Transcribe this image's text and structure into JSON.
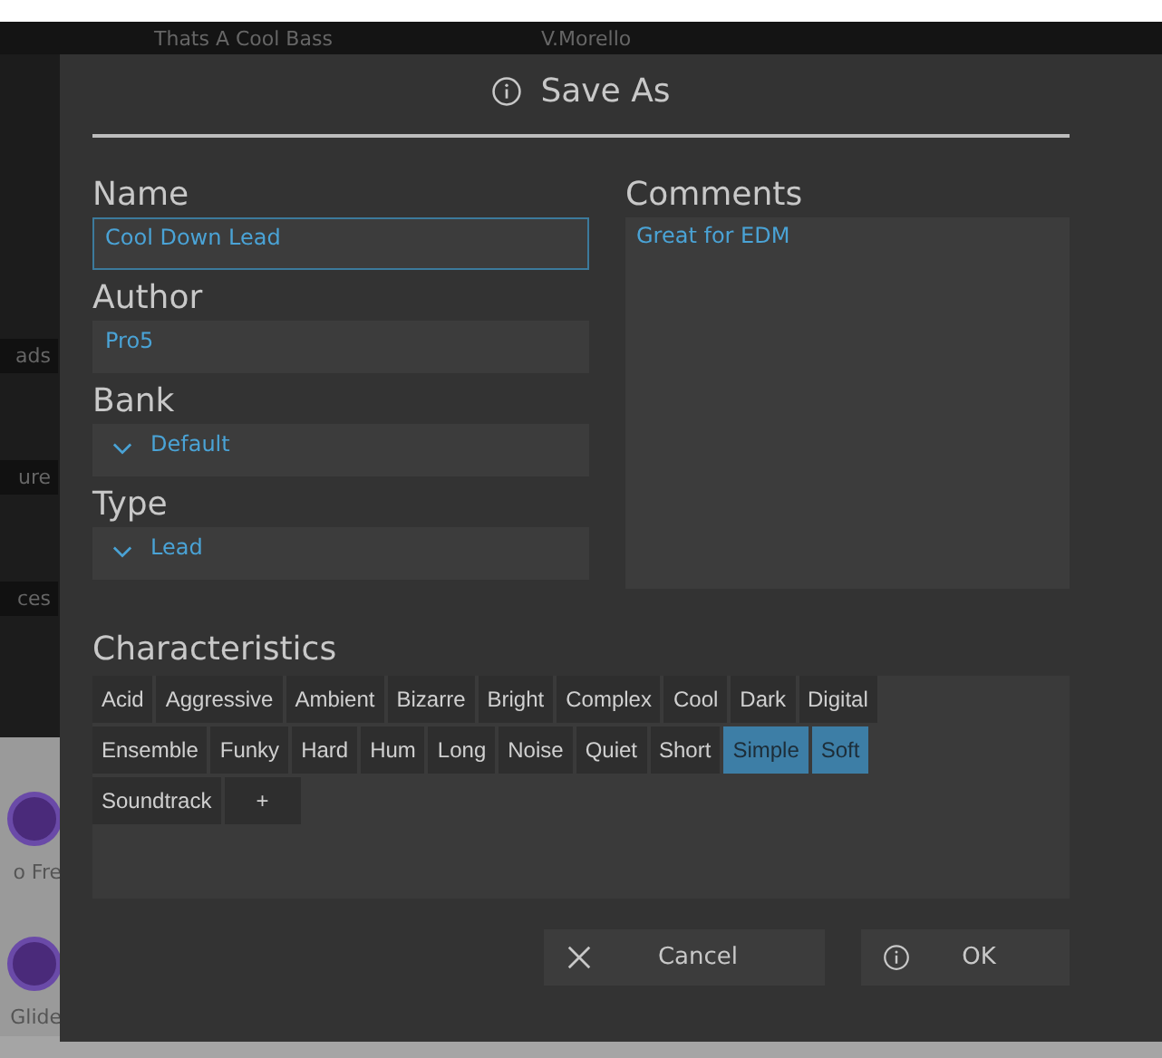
{
  "background": {
    "preset_row": {
      "name": "Thats A Cool Bass",
      "author": "V.Morello"
    },
    "side_tags": [
      "ads",
      "ure",
      "ces"
    ],
    "knob_labels": [
      "o Fre",
      "Glide"
    ]
  },
  "dialog": {
    "title": "Save As",
    "fields": [
      {
        "label": "Name",
        "kind": "text",
        "value": "Cool Down Lead",
        "focused": true
      },
      {
        "label": "Author",
        "kind": "text",
        "value": "Pro5",
        "focused": false
      },
      {
        "label": "Bank",
        "kind": "dropdown",
        "value": "Default",
        "focused": false
      },
      {
        "label": "Type",
        "kind": "dropdown",
        "value": "Lead",
        "focused": false
      }
    ],
    "comments": {
      "label": "Comments",
      "value": "Great for EDM"
    },
    "characteristics": {
      "label": "Characteristics",
      "tags": [
        {
          "label": "Acid",
          "selected": false
        },
        {
          "label": "Aggressive",
          "selected": false
        },
        {
          "label": "Ambient",
          "selected": false
        },
        {
          "label": "Bizarre",
          "selected": false
        },
        {
          "label": "Bright",
          "selected": false
        },
        {
          "label": "Complex",
          "selected": false
        },
        {
          "label": "Cool",
          "selected": false
        },
        {
          "label": "Dark",
          "selected": false
        },
        {
          "label": "Digital",
          "selected": false
        },
        {
          "label": "Ensemble",
          "selected": false
        },
        {
          "label": "Funky",
          "selected": false
        },
        {
          "label": "Hard",
          "selected": false
        },
        {
          "label": "Hum",
          "selected": false
        },
        {
          "label": "Long",
          "selected": false
        },
        {
          "label": "Noise",
          "selected": false
        },
        {
          "label": "Quiet",
          "selected": false
        },
        {
          "label": "Short",
          "selected": false
        },
        {
          "label": "Simple",
          "selected": true
        },
        {
          "label": "Soft",
          "selected": true
        },
        {
          "label": "Soundtrack",
          "selected": false
        }
      ],
      "add_button": "+"
    },
    "buttons": [
      {
        "label": "Cancel",
        "kind": "cancel"
      },
      {
        "label": "OK",
        "kind": "ok"
      }
    ]
  }
}
